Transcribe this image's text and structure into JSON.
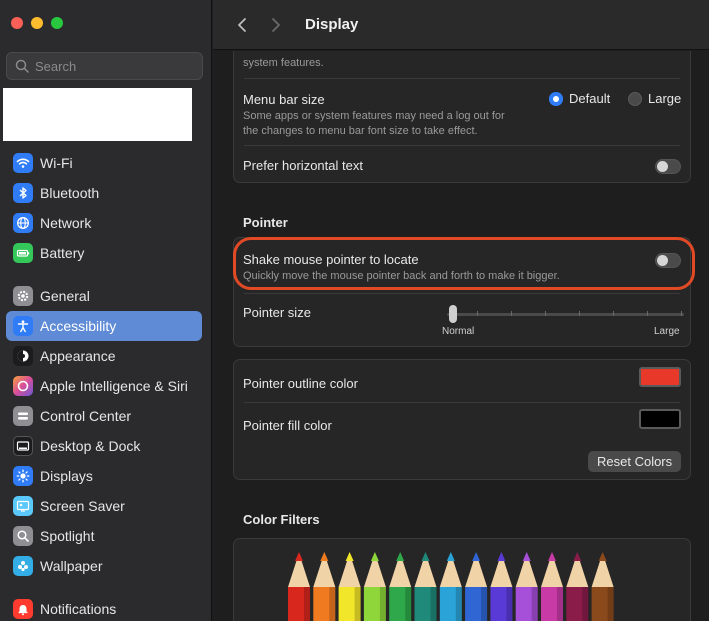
{
  "sidebar": {
    "search_placeholder": "Search",
    "items": [
      {
        "label": "Wi-Fi",
        "icon": "wifi-icon",
        "color": "#2f7cf6"
      },
      {
        "label": "Bluetooth",
        "icon": "bluetooth-icon",
        "color": "#2f7cf6"
      },
      {
        "label": "Network",
        "icon": "globe-icon",
        "color": "#2f7cf6"
      },
      {
        "label": "Battery",
        "icon": "battery-icon",
        "color": "#34c759"
      },
      {
        "label": "General",
        "icon": "gear-icon",
        "color": "#8e8e93"
      },
      {
        "label": "Accessibility",
        "icon": "accessibility-icon",
        "color": "#2f7cf6"
      },
      {
        "label": "Appearance",
        "icon": "appearance-icon",
        "color": "#1c1c1e"
      },
      {
        "label": "Apple Intelligence & Siri",
        "icon": "siri-icon",
        "color": "#d94d9a"
      },
      {
        "label": "Control Center",
        "icon": "control-center-icon",
        "color": "#8e8e93"
      },
      {
        "label": "Desktop & Dock",
        "icon": "dock-icon",
        "color": "#1c1c1e"
      },
      {
        "label": "Displays",
        "icon": "displays-icon",
        "color": "#2f7cf6"
      },
      {
        "label": "Screen Saver",
        "icon": "screen-saver-icon",
        "color": "#5ac8fa"
      },
      {
        "label": "Spotlight",
        "icon": "spotlight-icon",
        "color": "#8e8e93"
      },
      {
        "label": "Wallpaper",
        "icon": "wallpaper-icon",
        "color": "#32ade6"
      },
      {
        "label": "Notifications",
        "icon": "bell-icon",
        "color": "#ff3b30"
      }
    ]
  },
  "header": {
    "title": "Display"
  },
  "display": {
    "partial_sub": "system features.",
    "menu_bar_title": "Menu bar size",
    "menu_bar_sub_1": "Some apps or system features may need a log out for",
    "menu_bar_sub_2": "the changes to menu bar font size to take effect.",
    "menu_bar_options": [
      "Default",
      "Large"
    ],
    "menu_bar_selected": "Default",
    "prefer_horizontal": "Prefer horizontal text",
    "prefer_horizontal_on": false
  },
  "pointer": {
    "section": "Pointer",
    "shake_title": "Shake mouse pointer to locate",
    "shake_sub": "Quickly move the mouse pointer back and forth to make it bigger.",
    "shake_on": false,
    "size_title": "Pointer size",
    "size_min": "Normal",
    "size_max": "Large",
    "size_value": 0
  },
  "colors": {
    "outline_title": "Pointer outline color",
    "outline_color": "#e8382a",
    "fill_title": "Pointer fill color",
    "fill_color": "#000000",
    "reset_label": "Reset Colors"
  },
  "filters": {
    "section": "Color Filters",
    "pencil_colors": [
      "#d8281e",
      "#f07a20",
      "#f2e62a",
      "#8fd63a",
      "#2ea84a",
      "#1f8a7a",
      "#2aa4d8",
      "#2f66d4",
      "#5a3ad6",
      "#a64fd8",
      "#c83aa6",
      "#8a1c4a",
      "#8a4a1c"
    ]
  }
}
